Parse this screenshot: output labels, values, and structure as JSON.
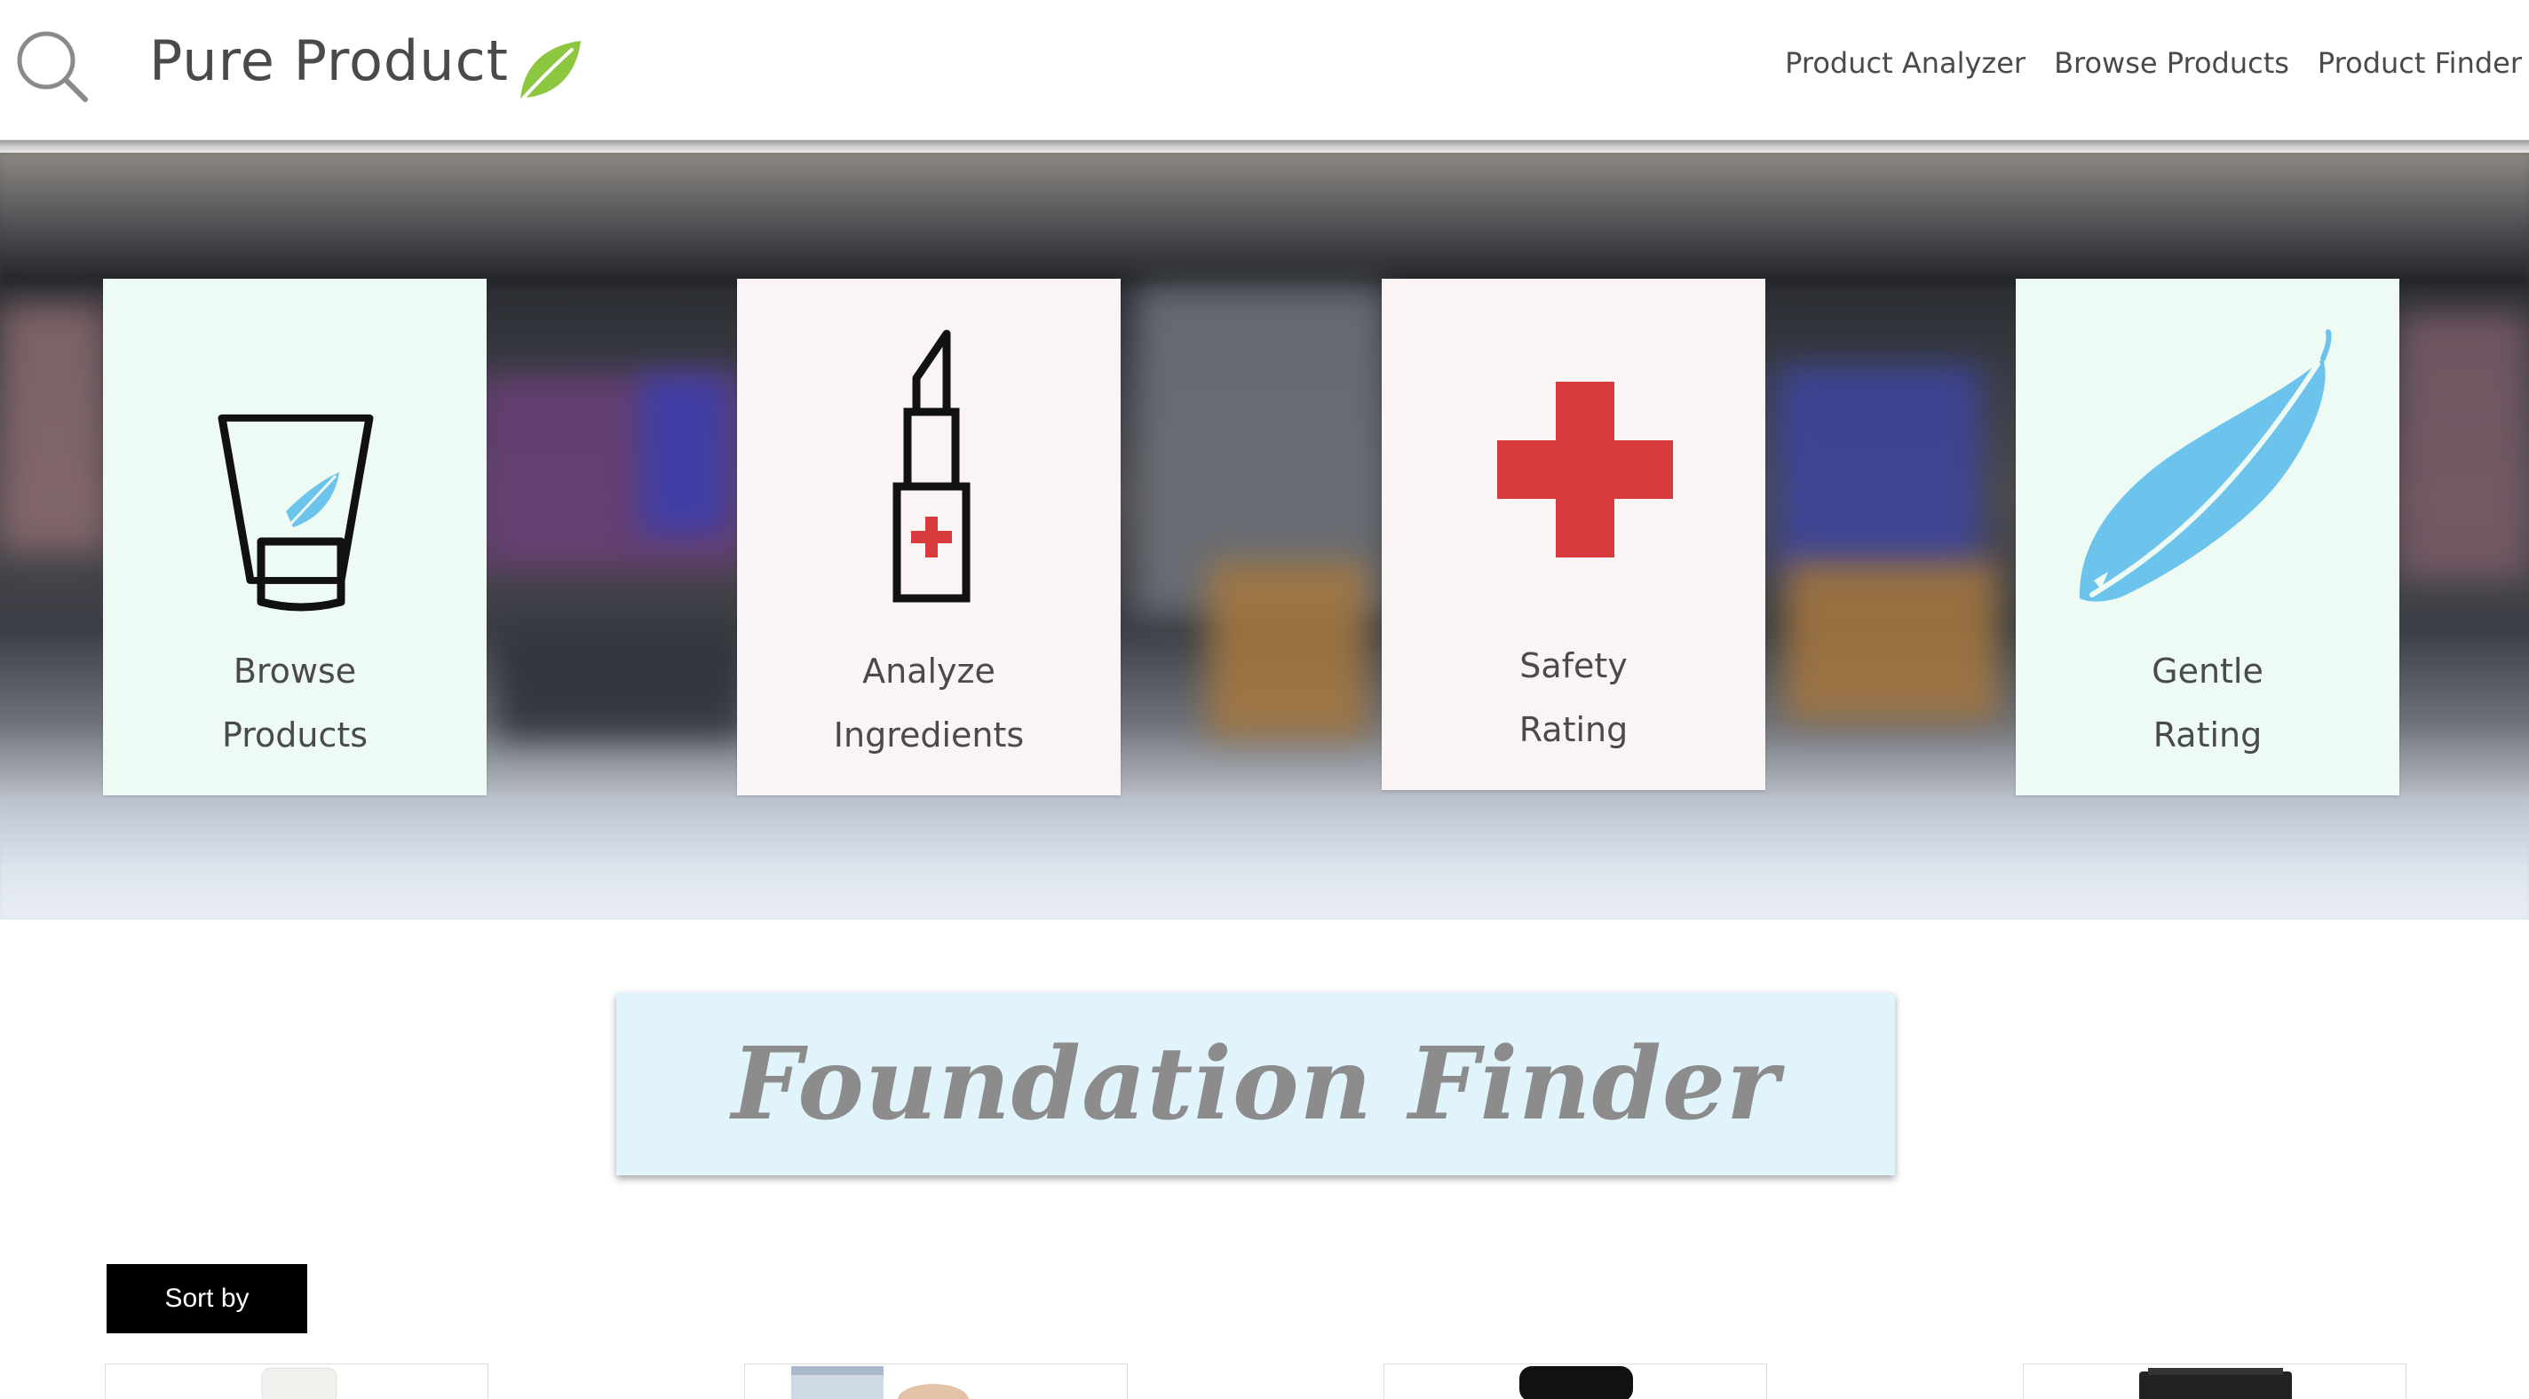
{
  "header": {
    "brand_title": "Pure Product",
    "nav": [
      {
        "label": "Product Analyzer"
      },
      {
        "label": "Browse Products"
      },
      {
        "label": "Product Finder"
      }
    ]
  },
  "hero": {
    "cards": [
      {
        "line1": "Browse",
        "line2": "Products",
        "icon": "tube-with-feather-icon"
      },
      {
        "line1": "Analyze",
        "line2": "Ingredients",
        "icon": "lipstick-with-cross-icon"
      },
      {
        "line1": "Safety",
        "line2": "Rating",
        "icon": "red-cross-icon"
      },
      {
        "line1": "Gentle",
        "line2": "Rating",
        "icon": "feather-icon"
      }
    ]
  },
  "finder": {
    "title": "Foundation Finder",
    "sort_label": "Sort by"
  },
  "colors": {
    "mint_card": "#eefbf4",
    "blush_card": "#fbf4f4",
    "accent_red": "#d93a3e",
    "feather_blue": "#6cc3ec",
    "leaf_green": "#8dc63f",
    "banner_blue": "#e1f3fb"
  }
}
